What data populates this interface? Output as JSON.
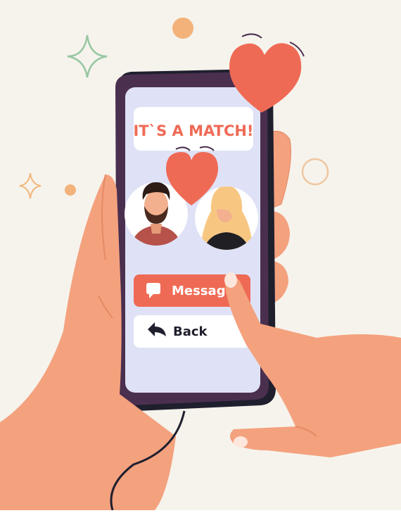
{
  "screen": {
    "title": "IT`S A MATCH!",
    "buttons": {
      "message_label": "Message",
      "back_label": "Back"
    }
  },
  "icons": {
    "message": "chat-bubble-icon",
    "back": "reply-arrow-icon",
    "heart": "heart-icon",
    "sparkle": "sparkle-icon"
  },
  "colors": {
    "background": "#f6f3ec",
    "accent_red": "#ef6a55",
    "phone_body": "#4a2f4f",
    "screen_bg": "#dfe2f6",
    "skin": "#f4a17e"
  }
}
